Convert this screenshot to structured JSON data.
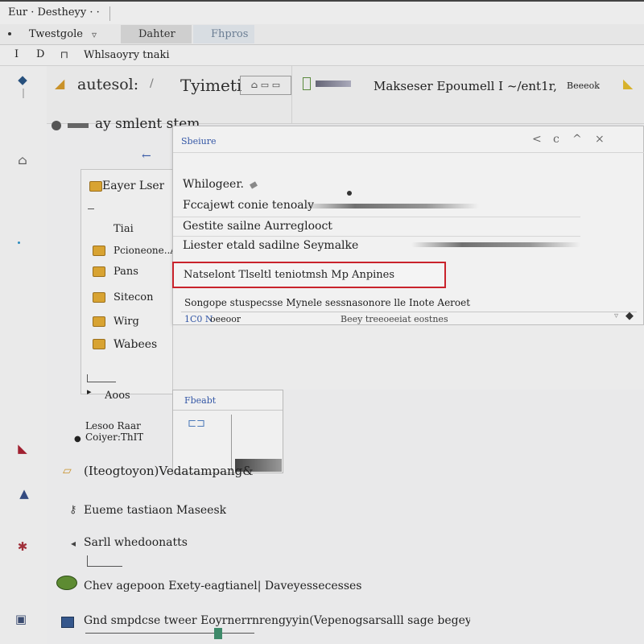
{
  "window": {
    "title": "Eur · Destheyy · ·",
    "close": "×"
  },
  "tabs": {
    "left_label": "Twestgole",
    "active": "Dahter",
    "second": "Fhpros"
  },
  "address": {
    "nav_a": "I",
    "nav_b": "D",
    "path": "Whlsaoyry tnaki"
  },
  "toolbar": {
    "item1": "autesol:",
    "item2": "Tyimeti",
    "item3": "Makseser  Epoumell  I  ~/ent1r,",
    "item4": "Beeeok"
  },
  "search": {
    "label": "ay smlent stem"
  },
  "list": {
    "header": "Eayer Lser",
    "items": [
      "Tiai",
      "Pcioneone..A",
      "Pans",
      "Sitecon",
      "Wirg",
      "Wabees"
    ],
    "footer": "Aoos"
  },
  "dialog": {
    "title": "Sbeiure",
    "controls": [
      "<",
      "c",
      "^",
      "×"
    ],
    "rows": [
      "Whilogeer.",
      "Fccajewt conie tenoaly",
      "Gestite sailne Aurreglooct",
      "Liester etald sadilne Seymalke"
    ],
    "highlighted": "Natselont Tlseltl teniotmsh Mp Anpines",
    "note": "Songope stuspecsse Mynele sessnasonore lle Inote Aeroet",
    "status_left": "1C0 N",
    "status_mid": "oeeoor",
    "status_right": "Beey treeoeeiat eostnes"
  },
  "popup": {
    "title": "Fbeabt"
  },
  "lower": {
    "item0a": "Lesoo Raar",
    "item0b": "Coiyer:ThIT",
    "item1": "(Iteogtoyon)Vedatampang&",
    "item2": "Eueme tastiaon Maseesk",
    "item3": "Sarll whedoonatts",
    "item4": "Chev agepoon Exety-eagtianel| Daveyessecesses",
    "item5": "Gnd smpdcse tweer Eoyrnerrnrengyyin(Vepenogsarsalll sage begey (N)."
  },
  "colors": {
    "highlight": "#c9232c",
    "link": "#3457a6",
    "folder": "#d8a332"
  }
}
